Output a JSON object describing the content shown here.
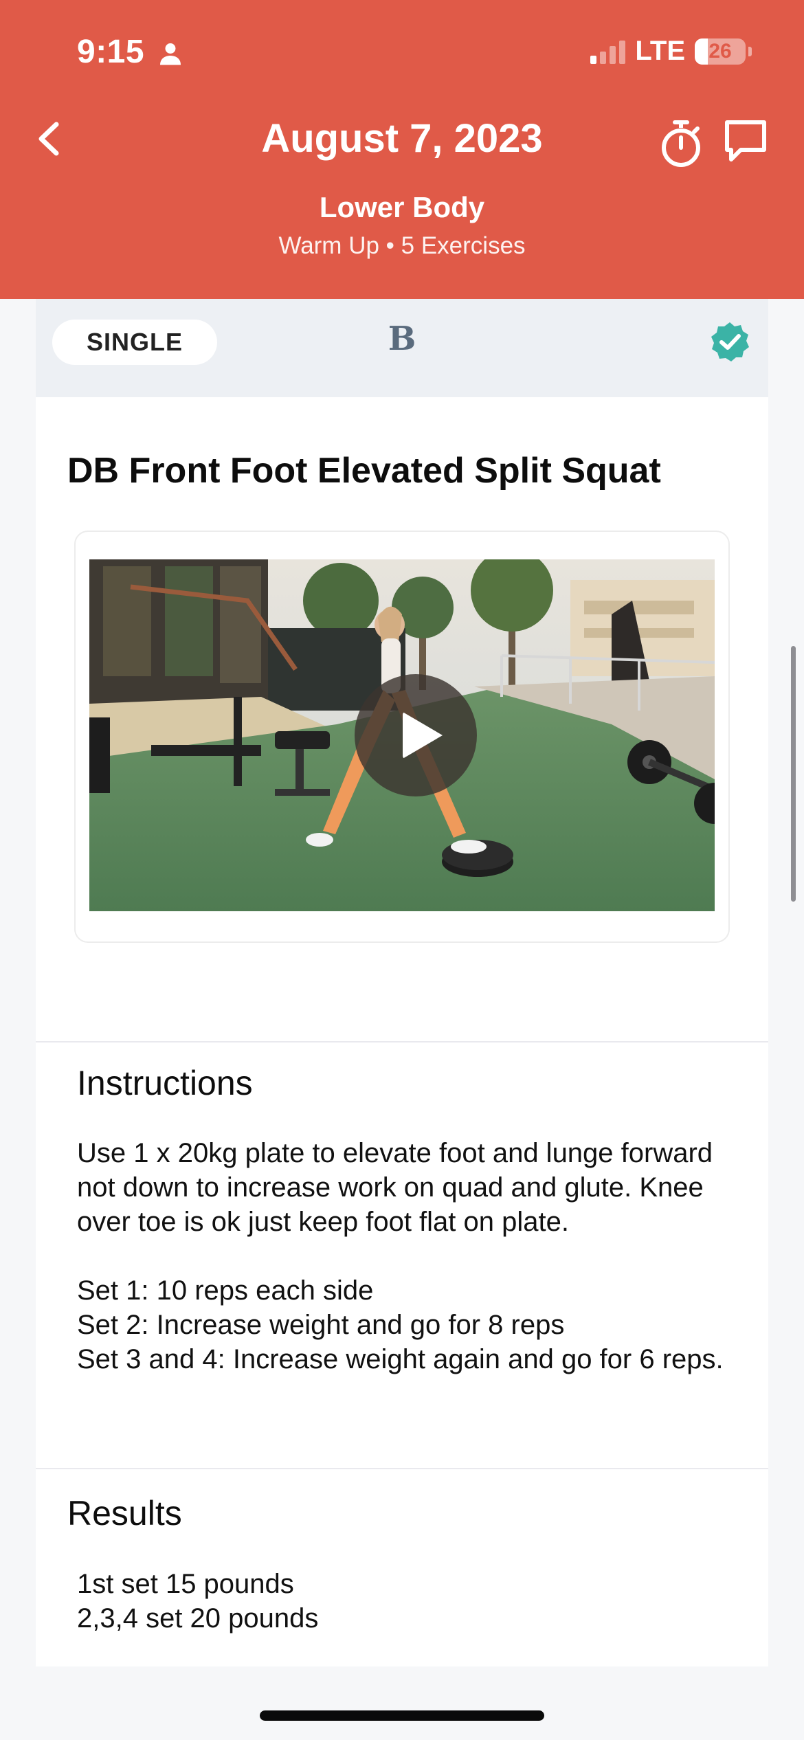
{
  "status_bar": {
    "time": "9:15",
    "network": "LTE",
    "battery": "26",
    "battery_level_percent": 26,
    "signal_bars_active": 1
  },
  "nav": {
    "title": "August 7, 2023",
    "back_icon": "chevron-left-icon",
    "timer_icon": "stopwatch-icon",
    "chat_icon": "chat-bubble-icon"
  },
  "workout": {
    "name": "Lower Body",
    "meta": "Warm Up • 5 Exercises"
  },
  "exercise_card": {
    "type_label": "SINGLE",
    "group_letter": "B",
    "completed_icon": "check-badge-icon",
    "title": "DB Front Foot Elevated Split Squat",
    "video_play_icon": "play-icon"
  },
  "instructions": {
    "heading": "Instructions",
    "text": "Use 1 x 20kg plate to elevate foot and lunge forward not down to increase work on quad and glute. Knee over toe is ok just keep foot flat on plate.\n\nSet 1: 10 reps each side\nSet 2: Increase weight and go for 8 reps\nSet 3 and 4: Increase weight again and go for 6 reps."
  },
  "results": {
    "heading": "Results",
    "text": "1st set 15 pounds\n2,3,4 set 20 pounds"
  },
  "colors": {
    "header_bg": "#e05a48",
    "accent_teal": "#3bb3a6",
    "card_top_bg": "#edf0f4"
  }
}
